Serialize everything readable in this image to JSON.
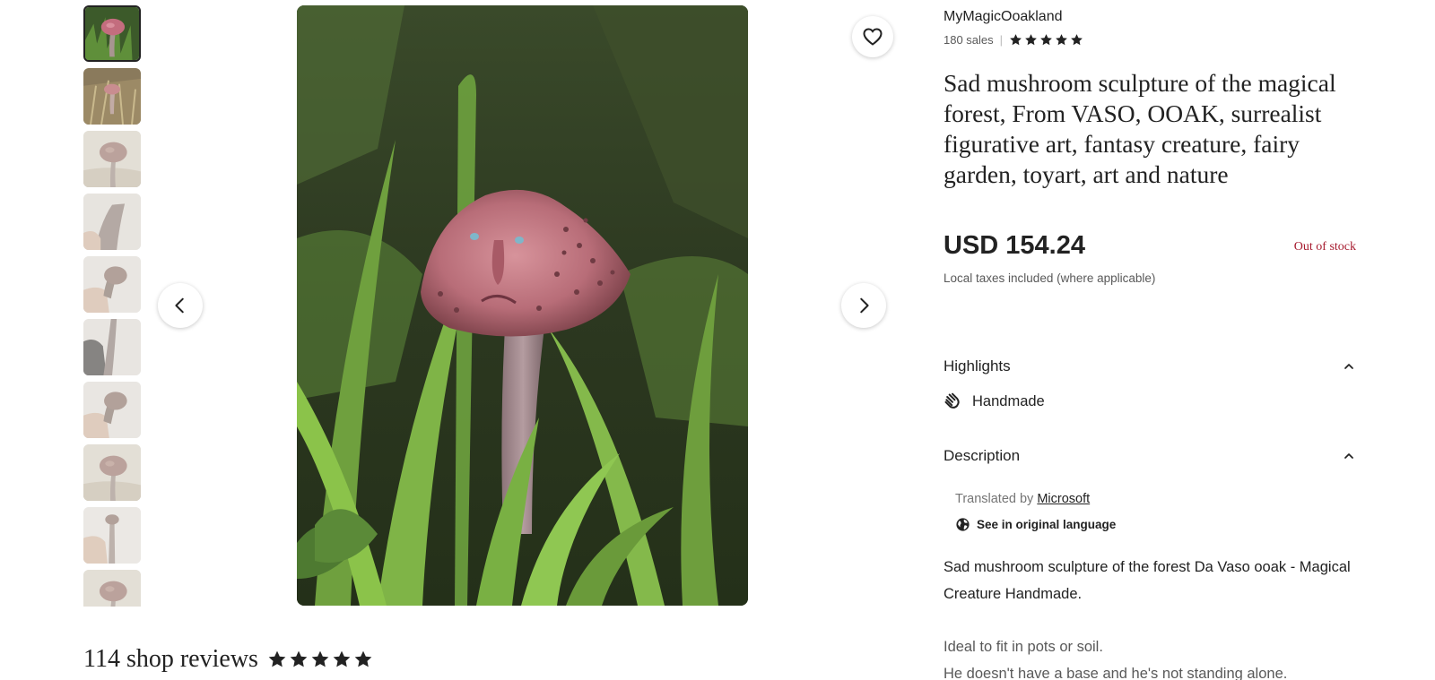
{
  "shop": {
    "name": "MyMagicOoakland",
    "sales": "180 sales",
    "rating_stars": 5
  },
  "listing": {
    "title": "Sad mushroom sculpture of the magical forest, From VASO, OOAK, surrealist figurative art, fantasy creature, fairy garden, toyart, art and nature",
    "price": "USD 154.24",
    "stock_status": "Out of stock",
    "tax_note": "Local taxes included (where applicable)"
  },
  "gallery": {
    "thumbnail_count": 10,
    "active_index": 0
  },
  "highlights": {
    "header": "Highlights",
    "items": [
      {
        "label": "Handmade",
        "icon": "handmade-icon"
      }
    ]
  },
  "description": {
    "header": "Description",
    "translated_by_prefix": "Translated by",
    "translator": "Microsoft",
    "see_original": "See in original language",
    "paragraphs": [
      "Sad mushroom sculpture of the forest Da Vaso ooak - Magical Creature Handmade.",
      "Ideal to fit in pots or soil.\nHe doesn't have a base and he's not standing alone."
    ]
  },
  "reviews": {
    "label": "114 shop reviews",
    "rating_stars": 5
  },
  "colors": {
    "text": "#222222",
    "muted": "#595959",
    "out_of_stock": "#a61a2e"
  },
  "icons": {
    "previous": "chevron-left-icon",
    "next": "chevron-right-icon",
    "favorite": "heart-icon",
    "collapse": "chevron-up-icon",
    "globe": "globe-icon",
    "star": "star-icon"
  }
}
